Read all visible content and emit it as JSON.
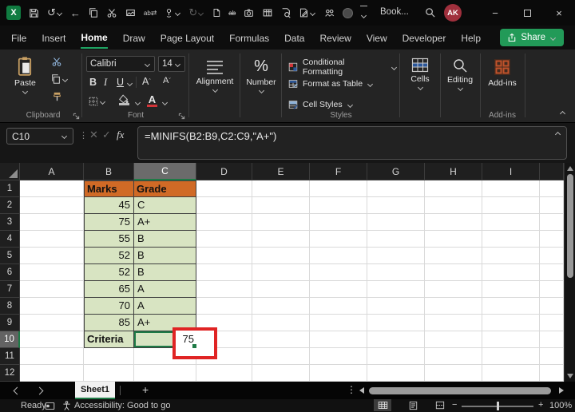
{
  "titlebar": {
    "title": "Book...",
    "avatar_initials": "AK"
  },
  "ribbon_tabs": {
    "items": [
      "File",
      "Insert",
      "Home",
      "Draw",
      "Page Layout",
      "Formulas",
      "Data",
      "Review",
      "View",
      "Developer",
      "Help"
    ],
    "active": "Home",
    "share_label": "Share"
  },
  "ribbon": {
    "clipboard": {
      "group_label": "Clipboard",
      "paste_label": "Paste"
    },
    "font": {
      "group_label": "Font",
      "font_name": "Calibri",
      "font_size": "14",
      "bold": "B",
      "italic": "I",
      "underline": "U"
    },
    "alignment": {
      "label": "Alignment"
    },
    "number": {
      "label": "Number",
      "glyph": "%"
    },
    "styles": {
      "group_label": "Styles",
      "conditional_formatting": "Conditional Formatting",
      "format_as_table": "Format as Table",
      "cell_styles": "Cell Styles"
    },
    "cells": {
      "label": "Cells"
    },
    "editing": {
      "label": "Editing"
    },
    "addins": {
      "button_label": "Add-ins",
      "group_label": "Add-ins"
    }
  },
  "formula_bar": {
    "name_box": "C10",
    "formula": "=MINIFS(B2:B9,C2:C9,\"A+\")"
  },
  "sheet": {
    "columns": [
      "A",
      "B",
      "C",
      "D",
      "E",
      "F",
      "G",
      "H",
      "I"
    ],
    "row_count": 12,
    "header_row": {
      "marks": "Marks",
      "grade": "Grade"
    },
    "records": [
      {
        "row": 2,
        "marks": "45",
        "grade": "C"
      },
      {
        "row": 3,
        "marks": "75",
        "grade": "A+"
      },
      {
        "row": 4,
        "marks": "55",
        "grade": "B"
      },
      {
        "row": 5,
        "marks": "52",
        "grade": "B"
      },
      {
        "row": 6,
        "marks": "52",
        "grade": "B"
      },
      {
        "row": 7,
        "marks": "65",
        "grade": "A"
      },
      {
        "row": 8,
        "marks": "70",
        "grade": "A"
      },
      {
        "row": 9,
        "marks": "85",
        "grade": "A+"
      }
    ],
    "criteria_label": "Criteria",
    "result_value": "75",
    "selected_cell": "C10",
    "selected_column": "C",
    "selected_row": 10
  },
  "sheet_tabs": {
    "active_sheet": "Sheet1",
    "add_label": "+"
  },
  "status_bar": {
    "mode": "Ready",
    "accessibility": "Accessibility: Good to go",
    "zoom_level": "100%"
  },
  "colors": {
    "accent_green": "#1E7A46",
    "header_orange": "#D06A26",
    "cell_green": "#D8E4C2",
    "annotation_red": "#E02424",
    "avatar_red": "#A0303D"
  }
}
